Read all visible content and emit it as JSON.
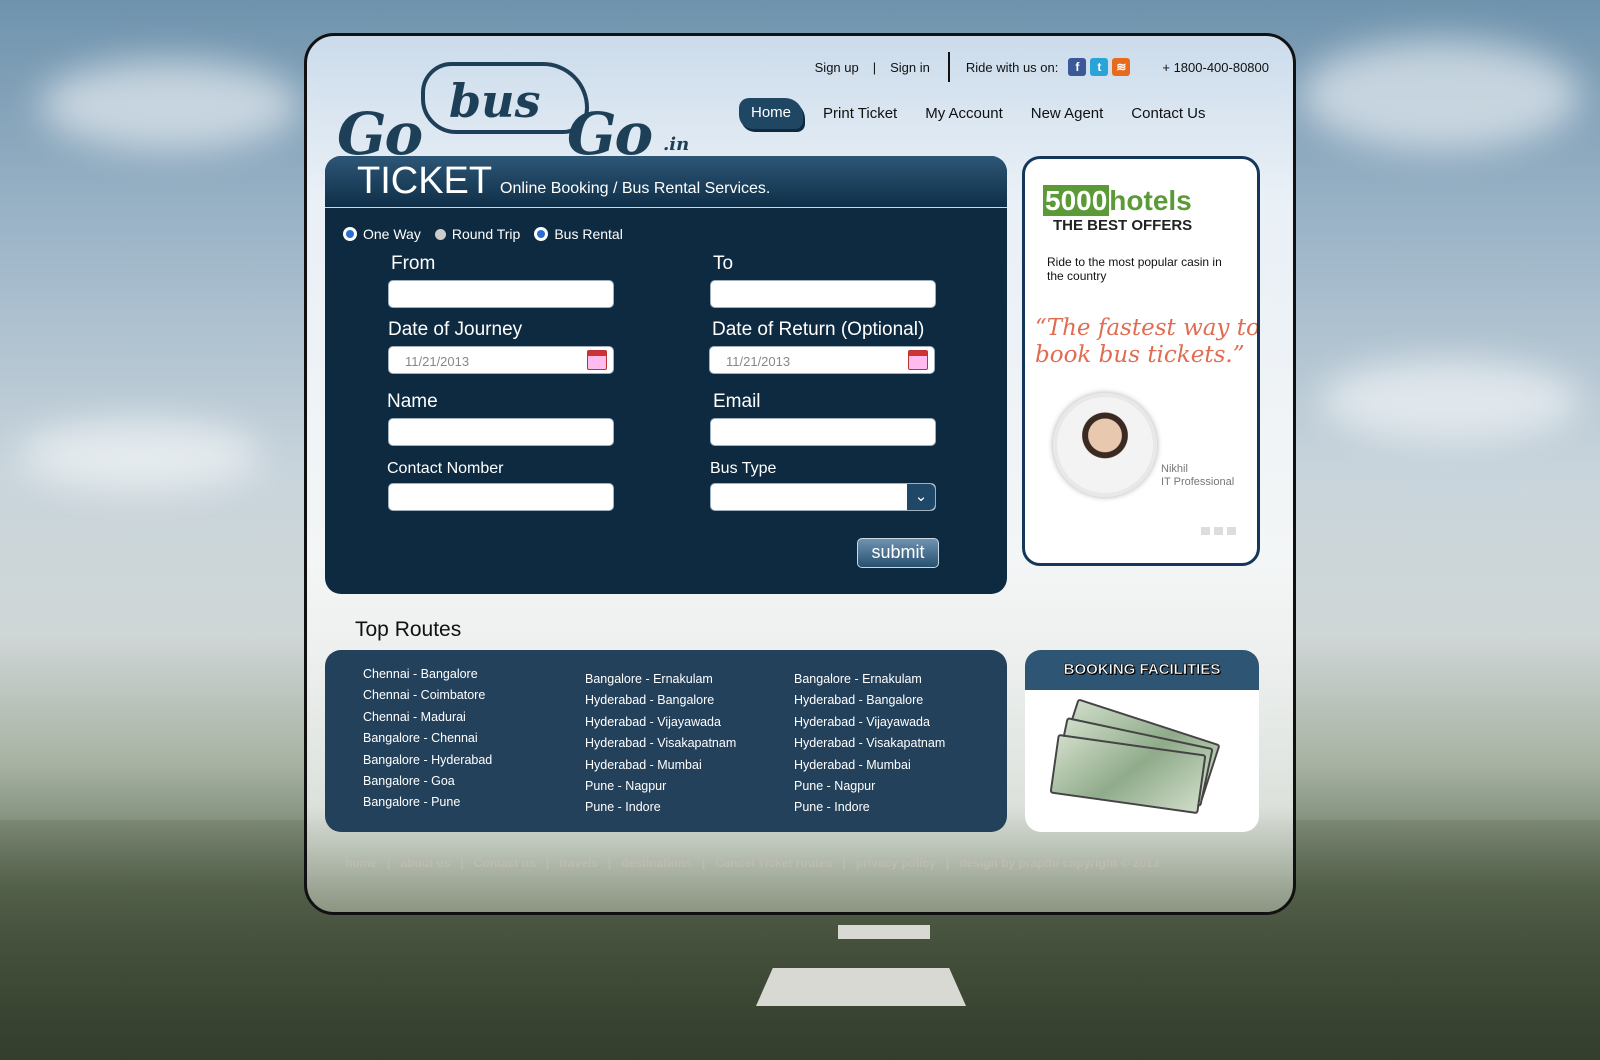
{
  "brand": {
    "logo_go1": "Go",
    "logo_bus": "bus",
    "logo_go2": "Go",
    "logo_in": ".in"
  },
  "toplinks": {
    "signup": "Sign up",
    "separator": "|",
    "signin": "Sign in",
    "ride_with_us": "Ride with us on:",
    "phone": "+ 1800-400-80800",
    "social": [
      {
        "name": "facebook-icon",
        "glyph": "f",
        "color": "#3b5998"
      },
      {
        "name": "twitter-icon",
        "glyph": "t",
        "color": "#2aa3d8"
      },
      {
        "name": "rss-icon",
        "glyph": "≋",
        "color": "#e66b1f"
      }
    ]
  },
  "nav": {
    "home": "Home",
    "print_ticket": "Print Ticket",
    "my_account": "My Account",
    "new_agent": "New Agent",
    "contact_us": "Contact Us"
  },
  "ticket": {
    "title": "TICKET",
    "subtitle": "Online Booking / Bus Rental Services.",
    "trip_types": [
      {
        "label": "One Way",
        "selected": true
      },
      {
        "label": "Round Trip",
        "selected": false
      },
      {
        "label": "Bus Rental",
        "selected": true
      }
    ],
    "from_label": "From",
    "to_label": "To",
    "date_journey_label": "Date of Journey",
    "date_return_label": "Date of Return (Optional)",
    "date_journey_value": "11/21/2013",
    "date_return_value": "11/21/2013",
    "name_label": "Name",
    "email_label": "Email",
    "contact_label": "Contact Nomber",
    "bus_type_label": "Bus Type",
    "submit": "submit"
  },
  "promo": {
    "hotels_num": "5000",
    "hotels_word": "hotels",
    "best_offers": "THE BEST OFFERS",
    "ride_text": "Ride to the most popular casin in the country",
    "quote": "“The fastest way to book bus tickets.”",
    "person_name": "Nikhil",
    "person_title": "IT Professional"
  },
  "routes": {
    "title": "Top Routes",
    "col1": [
      "Chennai - Bangalore",
      "Chennai - Coimbatore",
      "Chennai - Madurai",
      "Bangalore - Chennai",
      "Bangalore - Hyderabad",
      "Bangalore - Goa",
      "Bangalore - Pune"
    ],
    "col2": [
      "Bangalore - Ernakulam",
      "Hyderabad - Bangalore",
      "Hyderabad - Vijayawada",
      "Hyderabad - Visakapatnam",
      "Hyderabad - Mumbai",
      "Pune - Nagpur",
      "Pune - Indore"
    ],
    "col3": [
      "Bangalore - Ernakulam",
      "Hyderabad - Bangalore",
      "Hyderabad - Vijayawada",
      "Hyderabad - Visakapatnam",
      "Hyderabad - Mumbai",
      "Pune - Nagpur",
      "Pune - Indore"
    ]
  },
  "booking": {
    "title": "BOOKING FACILITIES"
  },
  "footer": [
    "home",
    "|",
    "about us",
    "|",
    "Contact us",
    "|",
    "travels",
    "|",
    "destinations",
    "|",
    "Cancel Ticket  routes",
    "|",
    "privacy policy",
    "|",
    "design by prapthi copyright © 2013"
  ]
}
